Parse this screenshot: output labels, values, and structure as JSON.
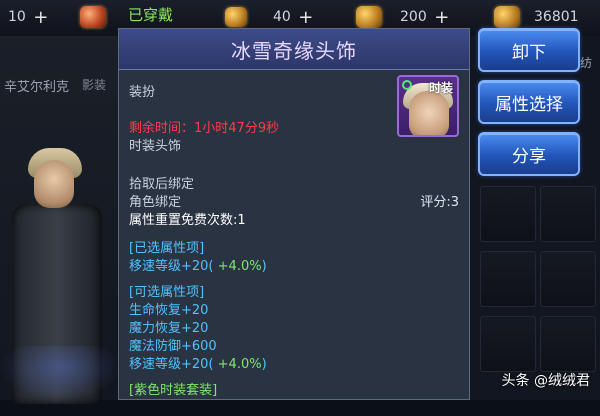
{
  "topbar": {
    "resources": [
      {
        "value": "10",
        "icon": "gold-icon"
      },
      {
        "value": "40",
        "icon": "ticket-icon"
      },
      {
        "value": "200",
        "icon": "diamond-icon"
      },
      {
        "value": "36801",
        "icon": "coin-icon"
      }
    ]
  },
  "background": {
    "character_name": "辛艾尔利克",
    "shadow_tab": "影装",
    "right_label": "纺"
  },
  "tooltip": {
    "worn_tag": "已穿戴",
    "title": "冰雪奇缘头饰",
    "category": "装扮",
    "remaining_time": "剩余时间：1小时47分9秒",
    "item_type": "时装头饰",
    "fashion_label": "时装",
    "bind_on_pickup": "拾取后绑定",
    "character_bound": "角色绑定",
    "score": "评分:3",
    "reset_free_times": "属性重置免费次数:1",
    "selected_section": {
      "title": "[已选属性项]",
      "stats": [
        {
          "name": "移速等级+20(",
          "bonus": "+4.0%",
          "close": ")"
        }
      ]
    },
    "optional_section": {
      "title": "[可选属性项]",
      "stats": [
        {
          "name": "生命恢复+20",
          "bonus": "",
          "close": ""
        },
        {
          "name": "魔力恢复+20",
          "bonus": "",
          "close": ""
        },
        {
          "name": "魔法防御+600",
          "bonus": "",
          "close": ""
        },
        {
          "name": "移速等级+20(",
          "bonus": "+4.0%",
          "close": ")"
        }
      ]
    },
    "set_name": "[紫色时装套装]"
  },
  "actions": {
    "unequip": "卸下",
    "attr_select": "属性选择",
    "share": "分享"
  },
  "watermark": "头条 @绒绒君",
  "colors": {
    "panel_bg": "#2a3342",
    "header_bg": "#3d4c8a",
    "time_red": "#ff3b4a",
    "stat_cyan": "#4fc3ff",
    "bonus_green": "#7de86b",
    "button_blue": "#2254b8"
  }
}
